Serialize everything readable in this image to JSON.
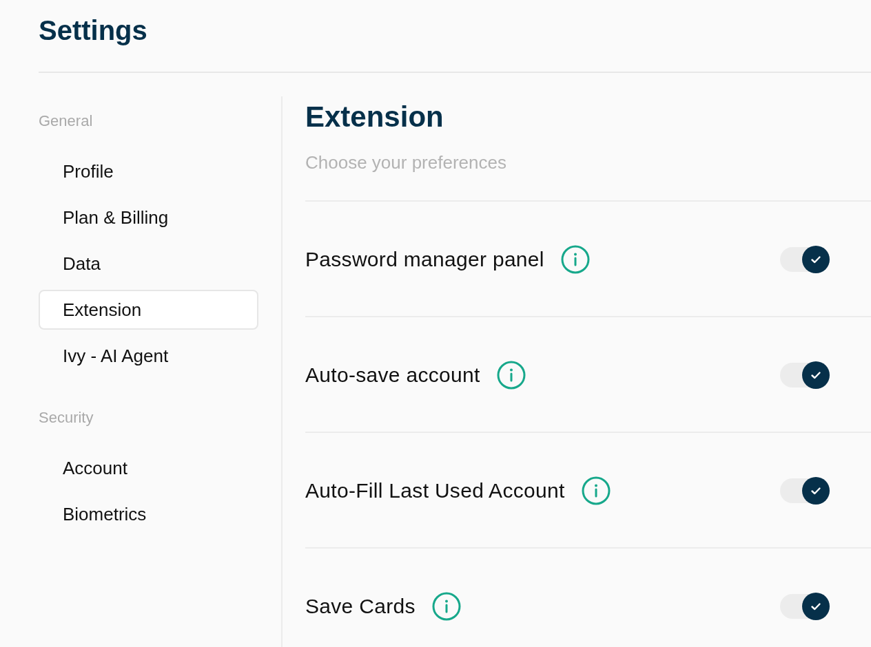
{
  "page": {
    "title": "Settings"
  },
  "sidebar": {
    "sections": [
      {
        "label": "General",
        "items": [
          {
            "label": "Profile",
            "selected": false
          },
          {
            "label": "Plan & Billing",
            "selected": false
          },
          {
            "label": "Data",
            "selected": false
          },
          {
            "label": "Extension",
            "selected": true
          },
          {
            "label": "Ivy - AI Agent",
            "selected": false
          }
        ]
      },
      {
        "label": "Security",
        "items": [
          {
            "label": "Account",
            "selected": false
          },
          {
            "label": "Biometrics",
            "selected": false
          }
        ]
      }
    ]
  },
  "panel": {
    "title": "Extension",
    "subtitle": "Choose your preferences",
    "settings": [
      {
        "label": "Password manager panel",
        "on": true
      },
      {
        "label": "Auto-save account",
        "on": true
      },
      {
        "label": "Auto-Fill Last Used Account",
        "on": true
      },
      {
        "label": "Save Cards",
        "on": true
      }
    ]
  }
}
